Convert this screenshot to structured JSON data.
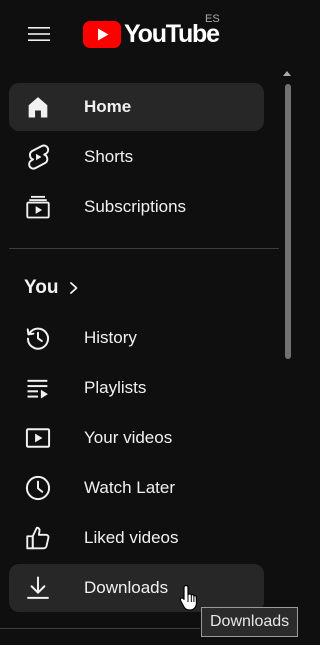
{
  "header": {
    "logo_text": "YouTube",
    "country_code": "ES"
  },
  "nav_primary": [
    {
      "label": "Home",
      "icon": "home-icon",
      "active": true
    },
    {
      "label": "Shorts",
      "icon": "shorts-icon"
    },
    {
      "label": "Subscriptions",
      "icon": "subscriptions-icon"
    }
  ],
  "you_section": {
    "title": "You",
    "items": [
      {
        "label": "History",
        "icon": "history-icon"
      },
      {
        "label": "Playlists",
        "icon": "playlists-icon"
      },
      {
        "label": "Your videos",
        "icon": "your-videos-icon"
      },
      {
        "label": "Watch Later",
        "icon": "watch-later-icon"
      },
      {
        "label": "Liked videos",
        "icon": "liked-videos-icon"
      },
      {
        "label": "Downloads",
        "icon": "downloads-icon",
        "hovered": true
      }
    ]
  },
  "tooltip": {
    "text": "Downloads"
  },
  "colors": {
    "background": "#0f0f0f",
    "active_item": "#272727",
    "brand_red": "#ff0000",
    "text": "#f1f1f1"
  }
}
